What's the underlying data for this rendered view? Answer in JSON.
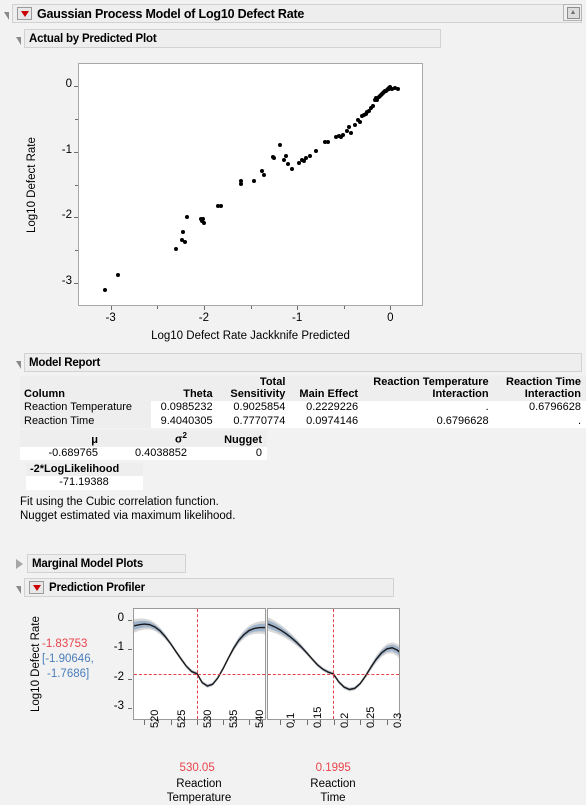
{
  "window": {
    "title": "Gaussian Process Model of Log10 Defect Rate",
    "icon": "window-restore-icon",
    "menu_icon": "red-triangle-menu-icon"
  },
  "sections": {
    "actual_by_predicted": {
      "title": "Actual by Predicted Plot"
    },
    "model_report": {
      "title": "Model Report"
    },
    "marginal_model_plots": {
      "title": "Marginal Model Plots",
      "expanded": false
    },
    "prediction_profiler": {
      "title": "Prediction Profiler",
      "expanded": true
    }
  },
  "chart_data": [
    {
      "type": "scatter",
      "title": "Actual by Predicted Plot",
      "xlabel": "Log10 Defect Rate Jackknife Predicted",
      "ylabel": "Log10 Defect Rate",
      "xlim": [
        -3.35,
        0.35
      ],
      "ylim": [
        -3.35,
        0.35
      ],
      "xticks": [
        -3,
        -2,
        -1,
        0
      ],
      "yticks": [
        0,
        -1,
        -2,
        -3
      ],
      "grid": false,
      "points": [
        [
          -3.06,
          -3.11
        ],
        [
          -2.92,
          -2.88
        ],
        [
          -2.3,
          -2.48
        ],
        [
          -2.24,
          -2.35
        ],
        [
          -2.22,
          -2.22
        ],
        [
          -2.2,
          -2.38
        ],
        [
          -2.18,
          -1.99
        ],
        [
          -2.03,
          -2.02
        ],
        [
          -2.02,
          -2.05
        ],
        [
          -2.01,
          -2.03
        ],
        [
          -2.0,
          -2.08
        ],
        [
          -1.85,
          -1.82
        ],
        [
          -1.82,
          -1.82
        ],
        [
          -1.6,
          -1.45
        ],
        [
          -1.6,
          -1.49
        ],
        [
          -1.46,
          -1.45
        ],
        [
          -1.38,
          -1.29
        ],
        [
          -1.35,
          -1.35
        ],
        [
          -1.26,
          -1.08
        ],
        [
          -1.25,
          -1.09
        ],
        [
          -1.18,
          -0.9
        ],
        [
          -1.14,
          -1.12
        ],
        [
          -1.12,
          -1.07
        ],
        [
          -1.1,
          -1.19
        ],
        [
          -1.05,
          -1.27
        ],
        [
          -0.98,
          -1.18
        ],
        [
          -0.95,
          -1.12
        ],
        [
          -0.93,
          -1.14
        ],
        [
          -0.9,
          -1.09
        ],
        [
          -0.86,
          -1.06
        ],
        [
          -0.8,
          -0.99
        ],
        [
          -0.7,
          -0.86
        ],
        [
          -0.67,
          -0.86
        ],
        [
          -0.58,
          -0.78
        ],
        [
          -0.55,
          -0.76
        ],
        [
          -0.53,
          -0.77
        ],
        [
          -0.51,
          -0.75
        ],
        [
          -0.47,
          -0.69
        ],
        [
          -0.44,
          -0.63
        ],
        [
          -0.42,
          -0.72
        ],
        [
          -0.38,
          -0.6
        ],
        [
          -0.35,
          -0.52
        ],
        [
          -0.33,
          -0.55
        ],
        [
          -0.3,
          -0.46
        ],
        [
          -0.28,
          -0.44
        ],
        [
          -0.26,
          -0.43
        ],
        [
          -0.25,
          -0.4
        ],
        [
          -0.23,
          -0.38
        ],
        [
          -0.21,
          -0.33
        ],
        [
          -0.19,
          -0.31
        ],
        [
          -0.17,
          -0.22
        ],
        [
          -0.15,
          -0.19
        ],
        [
          -0.14,
          -0.21
        ],
        [
          -0.12,
          -0.17
        ],
        [
          -0.11,
          -0.15
        ],
        [
          -0.1,
          -0.13
        ],
        [
          -0.09,
          -0.12
        ],
        [
          -0.08,
          -0.1
        ],
        [
          -0.07,
          -0.09
        ],
        [
          -0.06,
          -0.08
        ],
        [
          -0.05,
          -0.07
        ],
        [
          -0.04,
          -0.06
        ],
        [
          -0.03,
          -0.05
        ],
        [
          -0.02,
          -0.04
        ],
        [
          -0.01,
          -0.03
        ],
        [
          0.0,
          -0.02
        ],
        [
          0.02,
          -0.04
        ],
        [
          0.05,
          -0.03
        ],
        [
          0.08,
          -0.04
        ]
      ]
    },
    {
      "type": "line",
      "title": "Prediction Profiler - Reaction Temperature",
      "xlabel": "Reaction Temperature",
      "ylabel": "Log10 Defect Rate",
      "xlim": [
        518.0,
        543.0
      ],
      "ylim": [
        -3.4,
        0.4
      ],
      "xticks": [
        520,
        525,
        530,
        535,
        540
      ],
      "yticks": [
        0,
        -1,
        -2,
        -3
      ],
      "current_x": 530.05,
      "current_y": -1.83753,
      "ci": [
        -1.90646,
        -1.7686
      ],
      "curve": [
        [
          518.0,
          -0.18
        ],
        [
          519.0,
          -0.14
        ],
        [
          520.0,
          -0.12
        ],
        [
          521.0,
          -0.14
        ],
        [
          522.0,
          -0.22
        ],
        [
          523.0,
          -0.36
        ],
        [
          524.0,
          -0.56
        ],
        [
          525.0,
          -0.8
        ],
        [
          526.0,
          -1.07
        ],
        [
          527.0,
          -1.33
        ],
        [
          528.0,
          -1.58
        ],
        [
          529.0,
          -1.76
        ],
        [
          530.05,
          -1.84
        ],
        [
          531.0,
          -2.14
        ],
        [
          532.0,
          -2.26
        ],
        [
          533.0,
          -2.2
        ],
        [
          534.0,
          -1.98
        ],
        [
          535.0,
          -1.66
        ],
        [
          536.0,
          -1.3
        ],
        [
          537.0,
          -0.96
        ],
        [
          538.0,
          -0.68
        ],
        [
          539.0,
          -0.48
        ],
        [
          540.0,
          -0.34
        ],
        [
          541.0,
          -0.27
        ],
        [
          542.0,
          -0.24
        ],
        [
          543.0,
          -0.24
        ]
      ]
    },
    {
      "type": "line",
      "title": "Prediction Profiler - Reaction Time",
      "xlabel": "Reaction Time",
      "ylabel": "Log10 Defect Rate",
      "xlim": [
        0.077,
        0.323
      ],
      "ylim": [
        -3.4,
        0.4
      ],
      "xticks": [
        0.1,
        0.15,
        0.2,
        0.25,
        0.3
      ],
      "yticks": [
        0,
        -1,
        -2,
        -3
      ],
      "current_x": 0.1995,
      "current_y": -1.83753,
      "ci": [
        -1.90646,
        -1.7686
      ],
      "curve": [
        [
          0.077,
          -0.12
        ],
        [
          0.09,
          -0.22
        ],
        [
          0.1,
          -0.32
        ],
        [
          0.11,
          -0.44
        ],
        [
          0.12,
          -0.58
        ],
        [
          0.13,
          -0.74
        ],
        [
          0.14,
          -0.92
        ],
        [
          0.15,
          -1.12
        ],
        [
          0.16,
          -1.33
        ],
        [
          0.17,
          -1.53
        ],
        [
          0.18,
          -1.68
        ],
        [
          0.19,
          -1.78
        ],
        [
          0.1995,
          -1.84
        ],
        [
          0.21,
          -2.12
        ],
        [
          0.22,
          -2.3
        ],
        [
          0.23,
          -2.38
        ],
        [
          0.24,
          -2.34
        ],
        [
          0.25,
          -2.18
        ],
        [
          0.26,
          -1.92
        ],
        [
          0.27,
          -1.62
        ],
        [
          0.28,
          -1.34
        ],
        [
          0.29,
          -1.12
        ],
        [
          0.3,
          -0.98
        ],
        [
          0.31,
          -0.94
        ],
        [
          0.32,
          -1.02
        ],
        [
          0.323,
          -1.08
        ]
      ]
    }
  ],
  "model_report": {
    "columns": [
      "Column",
      "Theta",
      "Total Sensitivity",
      "Main Effect",
      "Reaction Temperature Interaction",
      "Reaction Time Interaction"
    ],
    "columns_wrapped": [
      [
        "",
        "Column"
      ],
      [
        "",
        "Theta"
      ],
      [
        "Total",
        "Sensitivity"
      ],
      [
        "",
        "Main Effect"
      ],
      [
        "Reaction Temperature",
        "Interaction"
      ],
      [
        "Reaction Time",
        "Interaction"
      ]
    ],
    "rows": [
      {
        "column": "Reaction Temperature",
        "theta": "0.0985232",
        "total_sensitivity": "0.9025854",
        "main_effect": "0.2229226",
        "rt_temp_interaction": ".",
        "rt_time_interaction": "0.6796628"
      },
      {
        "column": "Reaction Time",
        "theta": "9.4040305",
        "total_sensitivity": "0.7770774",
        "main_effect": "0.0974146",
        "rt_temp_interaction": "0.6796628",
        "rt_time_interaction": "."
      }
    ],
    "params": {
      "headers": [
        "μ",
        "σ²",
        "Nugget"
      ],
      "values": [
        "-0.689765",
        "0.4038852",
        "0"
      ]
    },
    "loglik": {
      "header": "-2*LogLikelihood",
      "value": "-71.19388"
    },
    "notes": [
      "Fit using the Cubic correlation function.",
      "Nugget estimated via maximum likelihood."
    ]
  },
  "profiler": {
    "ylabel": "Log10 Defect Rate",
    "prediction": "-1.83753",
    "ci_line1": "[-1.90646,",
    "ci_line2": "-1.7686]",
    "factors": [
      {
        "name_line1": "Reaction",
        "name_line2": "Temperature",
        "current": "530.05",
        "ticklabels": [
          "520",
          "525",
          "530",
          "535",
          "540"
        ]
      },
      {
        "name_line1": "Reaction",
        "name_line2": "Time",
        "current": "0.1995",
        "ticklabels": [
          "0.1",
          "0.15",
          "0.2",
          "0.25",
          "0.3"
        ]
      }
    ],
    "yticklabels": [
      "0",
      "-1",
      "-2",
      "-3"
    ]
  },
  "colors": {
    "accent_red": "#e8434a",
    "ci_blue": "#4a7ebb",
    "menu_red": "#cc0000",
    "panel_bg": "#eeeeee",
    "page_bg": "#f2f2f2"
  }
}
